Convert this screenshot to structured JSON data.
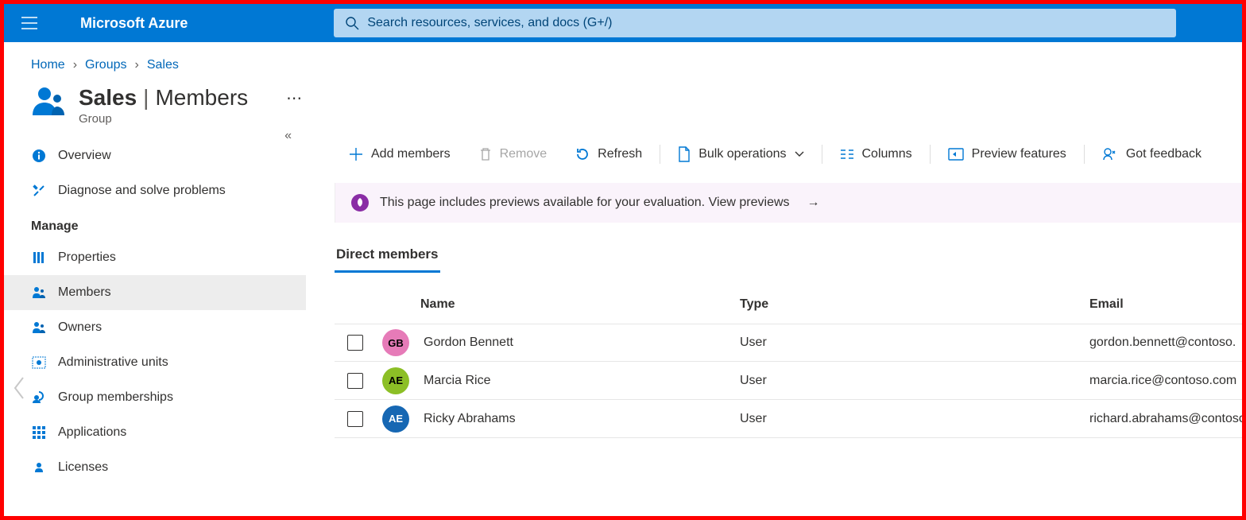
{
  "brand": "Microsoft Azure",
  "search": {
    "placeholder": "Search resources, services, and docs (G+/)"
  },
  "breadcrumb": {
    "home": "Home",
    "groups": "Groups",
    "current": "Sales"
  },
  "header": {
    "title_strong": "Sales",
    "title_sep": " | ",
    "title_light": "Members",
    "subtitle": "Group"
  },
  "sidebar": {
    "overview": "Overview",
    "diagnose": "Diagnose and solve problems",
    "manage_label": "Manage",
    "properties": "Properties",
    "members": "Members",
    "owners": "Owners",
    "admin_units": "Administrative units",
    "group_memberships": "Group memberships",
    "applications": "Applications",
    "licenses": "Licenses"
  },
  "toolbar": {
    "add_members": "Add members",
    "remove": "Remove",
    "refresh": "Refresh",
    "bulk": "Bulk operations",
    "columns": "Columns",
    "preview_features": "Preview features",
    "feedback": "Got feedback"
  },
  "banner": {
    "text": "This page includes previews available for your evaluation. View previews"
  },
  "tabs": {
    "direct_members": "Direct members"
  },
  "table": {
    "headers": {
      "name": "Name",
      "type": "Type",
      "email": "Email"
    },
    "rows": [
      {
        "initials": "GB",
        "color": "#e67bb8",
        "name": "Gordon Bennett",
        "type": "User",
        "email": "gordon.bennett@contoso."
      },
      {
        "initials": "AE",
        "color": "#8cbf26",
        "name": "Marcia Rice",
        "type": "User",
        "email": "marcia.rice@contoso.com"
      },
      {
        "initials": "AE",
        "color": "#1667b3",
        "name": "Ricky Abrahams",
        "type": "User",
        "email": "richard.abrahams@contoso"
      }
    ]
  }
}
